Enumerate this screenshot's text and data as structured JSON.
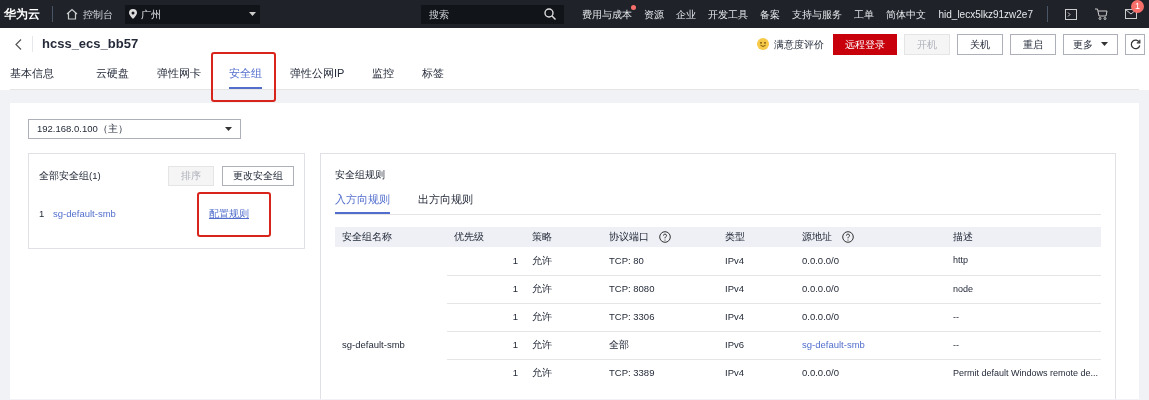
{
  "top_bar": {
    "logo": "华为云",
    "console": "控制台",
    "region": "广州",
    "search_placeholder": "搜索",
    "nav": [
      {
        "label": "费用与成本",
        "dot": true
      },
      {
        "label": "资源",
        "dot": false
      },
      {
        "label": "企业",
        "dot": false
      },
      {
        "label": "开发工具",
        "dot": false
      },
      {
        "label": "备案",
        "dot": false
      },
      {
        "label": "支持与服务",
        "dot": false
      },
      {
        "label": "工单",
        "dot": false
      },
      {
        "label": "简体中文",
        "dot": false
      },
      {
        "label": "hid_lecx5lkz91zw2e7",
        "dot": false
      }
    ],
    "message_count": "1"
  },
  "header": {
    "title": "hcss_ecs_bb57",
    "rating": "满意度评价",
    "buttons": [
      {
        "label": "远程登录",
        "kind": "primary"
      },
      {
        "label": "开机",
        "kind": "disabled"
      },
      {
        "label": "关机",
        "kind": "default"
      },
      {
        "label": "重启",
        "kind": "default"
      },
      {
        "label": "更多",
        "kind": "dropdown"
      }
    ]
  },
  "tabs": [
    {
      "label": "基本信息",
      "selected": false,
      "highlighted": false
    },
    {
      "label": "云硬盘",
      "selected": false,
      "highlighted": false
    },
    {
      "label": "弹性网卡",
      "selected": false,
      "highlighted": false
    },
    {
      "label": "安全组",
      "selected": true,
      "highlighted": true
    },
    {
      "label": "弹性公网IP",
      "selected": false,
      "highlighted": false
    },
    {
      "label": "监控",
      "selected": false,
      "highlighted": false
    },
    {
      "label": "标签",
      "selected": false,
      "highlighted": false
    }
  ],
  "nic_select": "192.168.0.100（主）",
  "groups_panel": {
    "title": "全部安全组(1)",
    "buttons": [
      {
        "label": "排序",
        "disabled": true
      },
      {
        "label": "更改安全组",
        "disabled": false
      }
    ],
    "groups": [
      {
        "index": "1",
        "name": "sg-default-smb",
        "action": "配置规则",
        "highlighted": true
      }
    ]
  },
  "rules_panel": {
    "title": "安全组规则",
    "tabs": [
      {
        "label": "入方向规则",
        "selected": true
      },
      {
        "label": "出方向规则",
        "selected": false
      }
    ],
    "columns": [
      {
        "label": "安全组名称",
        "help": false
      },
      {
        "label": "优先级",
        "help": false
      },
      {
        "label": "策略",
        "help": false
      },
      {
        "label": "协议端口",
        "help": true
      },
      {
        "label": "类型",
        "help": false
      },
      {
        "label": "源地址",
        "help": true
      },
      {
        "label": "描述",
        "help": false
      }
    ],
    "group_name": "sg-default-smb",
    "rows": [
      {
        "priority": "1",
        "action": "允许",
        "port": "TCP: 80",
        "type": "IPv4",
        "source": "0.0.0.0/0",
        "source_is_link": false,
        "description": "http"
      },
      {
        "priority": "1",
        "action": "允许",
        "port": "TCP: 8080",
        "type": "IPv4",
        "source": "0.0.0.0/0",
        "source_is_link": false,
        "description": "node"
      },
      {
        "priority": "1",
        "action": "允许",
        "port": "TCP: 3306",
        "type": "IPv4",
        "source": "0.0.0.0/0",
        "source_is_link": false,
        "description": "--"
      },
      {
        "priority": "1",
        "action": "允许",
        "port": "全部",
        "type": "IPv6",
        "source": "sg-default-smb",
        "source_is_link": true,
        "description": "--"
      },
      {
        "priority": "1",
        "action": "允许",
        "port": "TCP: 3389",
        "type": "IPv4",
        "source": "0.0.0.0/0",
        "source_is_link": false,
        "description": "Permit default Windows remote de..."
      }
    ]
  }
}
